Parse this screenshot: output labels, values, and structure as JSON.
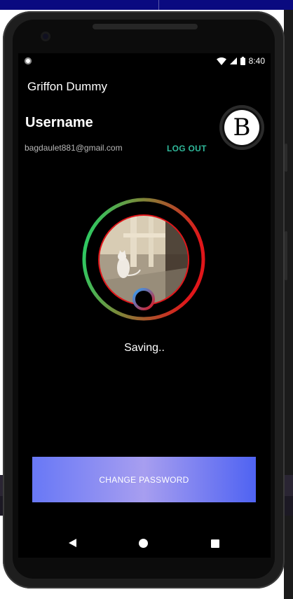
{
  "status_bar": {
    "time": "8:40",
    "icons": [
      "notification-dot-icon",
      "wifi-icon",
      "cell-signal-icon",
      "battery-icon"
    ]
  },
  "app": {
    "title": "Griffon Dummy"
  },
  "profile": {
    "username": "Username",
    "email": "bagdaulet881@gmail.com",
    "logout_label": "LOG OUT",
    "badge_letter": "B",
    "avatar_icon": "cat-photo",
    "status_text": "Saving.."
  },
  "actions": {
    "change_password_label": "CHANGE PASSWORD"
  },
  "nav": {
    "icons": [
      "back-icon",
      "home-icon",
      "recents-icon"
    ]
  },
  "colors": {
    "accent_logout": "#2fb89a",
    "ring_start": "#1ed66a",
    "ring_end": "#e0161a",
    "button_gradient": [
      "#6878f6",
      "#a79ef0",
      "#4f63f2"
    ]
  }
}
